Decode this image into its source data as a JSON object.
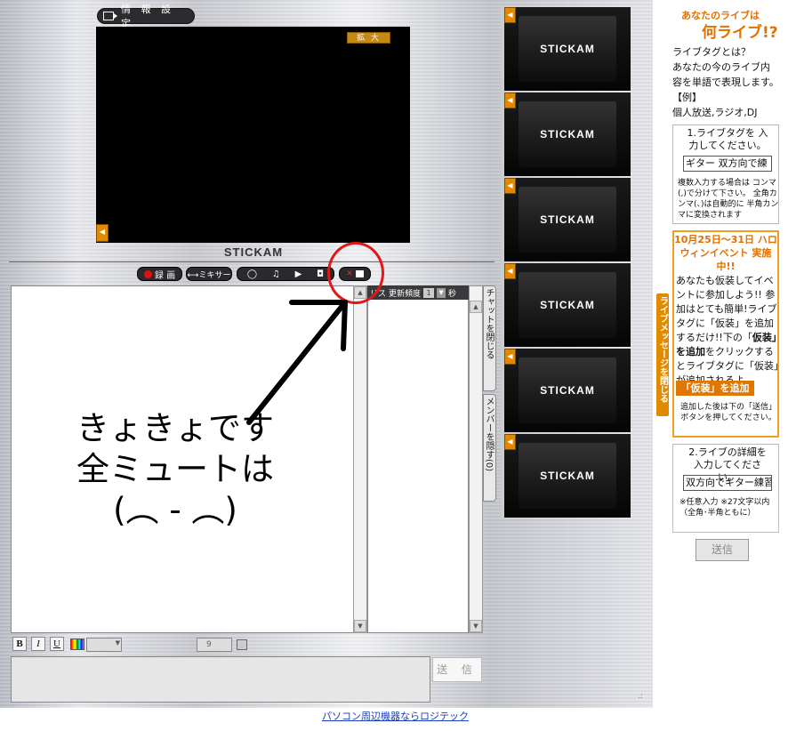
{
  "top_bar": {
    "info_settings": "情 報 設 定"
  },
  "video": {
    "zoom_label": "拡 大",
    "logo": "STICKAM"
  },
  "toolbar": {
    "record_label": "録 画",
    "mixer_label": "⟷ミキサー"
  },
  "list_panel": {
    "header_left": "リス",
    "header_freq": "更新頻度",
    "header_freq_value": "1",
    "header_unit": "秒"
  },
  "side_tabs": {
    "close_chat": "チャットを閉じる",
    "hide_member": "メンバーを隠す(0)"
  },
  "annotation": {
    "line1": "きょきょです",
    "line2": "全ミュートは",
    "line3": "(︵ - ︵)"
  },
  "formatting": {
    "bold": "B",
    "italic": "I",
    "underline": "U",
    "size_value": "9"
  },
  "composer": {
    "send_label": "送 信"
  },
  "footer": {
    "link_text": "パソコン周辺機器ならロジテック"
  },
  "thumbnails": [
    {
      "logo": "STICKAM"
    },
    {
      "logo": "STICKAM"
    },
    {
      "logo": "STICKAM"
    },
    {
      "logo": "STICKAM"
    },
    {
      "logo": "STICKAM"
    },
    {
      "logo": "STICKAM"
    }
  ],
  "sidebar": {
    "promo_line1": "あなたのライブは",
    "promo_line2": "何ライブ!?",
    "desc": [
      "ライブタグとは？",
      "あなたの今のライブ内",
      "容を単語で表現します。",
      "【例】",
      "個人放送,ラジオ,DJ"
    ],
    "step1_title": "1.ライブタグを 入力してください。",
    "step1_value": "ギター 双方向で練",
    "step1_note": "複数入力する場合は コンマ(,)で分けて下さい。 全角カンマ(、)は自動的に 半角カンマに変換されます",
    "event_title": "10月25日～31日 ハロウィンイベント 実施中!!",
    "event_body_1": "あなたも仮装してイベントに参加しよう!! 参加はとても簡単!ライブタグに「仮装」を追加するだけ!!下の「",
    "event_body_bold1": "仮装」を追加",
    "event_body_2": "をクリックするとライブタグに「仮装」が追加されるよ。",
    "add_costume": "「仮装」を追加",
    "event_note": "追加した後は下の「送信」ボタンを押してください。",
    "close_message": "ライブメッセージを閉じる",
    "step2_title": "2.ライブの詳細を 入力してください。",
    "step2_value": "双方向でギター練習",
    "step2_note": "※任意入力 ※27文字以内 （全角･半角ともに）",
    "send_label": "送信"
  }
}
